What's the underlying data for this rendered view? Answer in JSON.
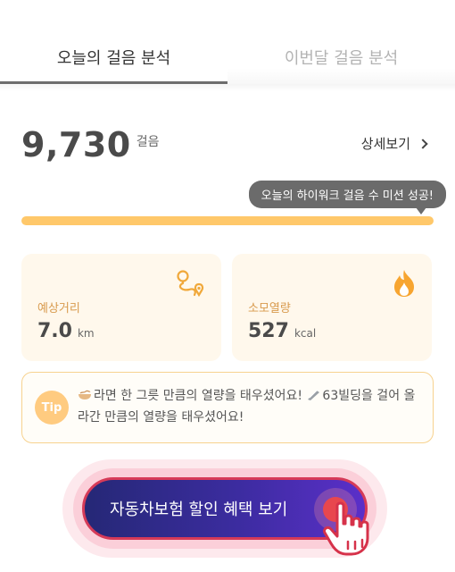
{
  "tabs": [
    {
      "label": "오늘의 걸음 분석",
      "active": true
    },
    {
      "label": "이번달 걸음 분석",
      "active": false
    }
  ],
  "summary": {
    "steps_value": "9,730",
    "steps_unit": "걸음",
    "detail_label": "상세보기"
  },
  "tooltip": "오늘의 하이워크 걸음 수 미션 성공!",
  "progress": {
    "fraction": 1.0
  },
  "cards": {
    "distance": {
      "label": "예상거리",
      "value": "7.0",
      "unit": "km",
      "icon": "route-pin-icon"
    },
    "calories": {
      "label": "소모열량",
      "value": "527",
      "unit": "kcal",
      "icon": "flame-icon"
    }
  },
  "tip": {
    "badge": "Tip",
    "text_part1": "라면 한 그릇 만큼의 열량을 태우셨어요!",
    "text_part2": "63빌딩을 걸어 올라간 만큼의 열량을 태우셨어요!",
    "icons": [
      "noodle-bowl-icon",
      "sneaker-icon"
    ]
  },
  "cta": {
    "label": "자동차보험 할인 혜택 보기"
  },
  "colors": {
    "accent": "#ffc86a",
    "card_bg": "#fff8ec",
    "label_orange": "#d89a4d",
    "cta_start": "#252876",
    "cta_end": "#5b2fc9",
    "cta_border": "#d63a58"
  }
}
